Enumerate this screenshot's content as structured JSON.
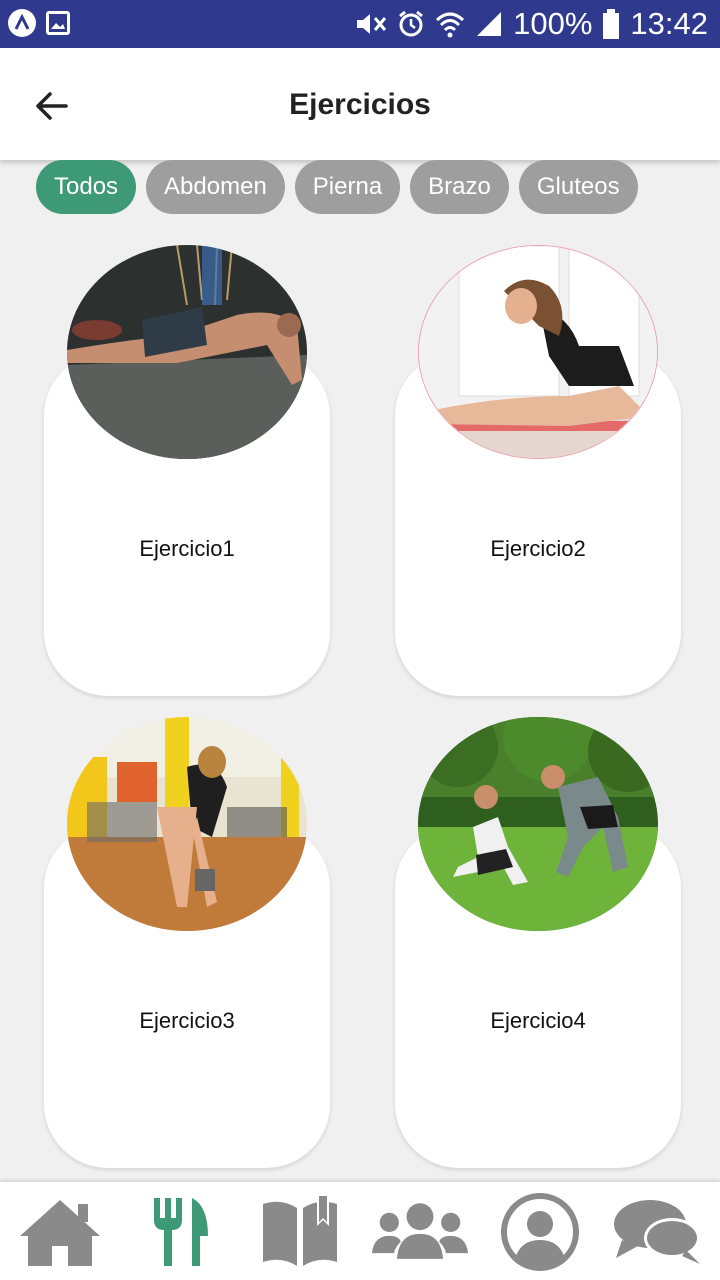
{
  "status_bar": {
    "battery": "100%",
    "time": "13:42",
    "icons": [
      "app-icon",
      "image-icon",
      "mute-icon",
      "alarm-icon",
      "wifi-icon",
      "signal-icon",
      "battery-icon"
    ]
  },
  "header": {
    "title": "Ejercicios",
    "back_icon": "back-arrow-icon"
  },
  "filters": [
    {
      "label": "Todos",
      "active": true
    },
    {
      "label": "Abdomen",
      "active": false
    },
    {
      "label": "Pierna",
      "active": false
    },
    {
      "label": "Brazo",
      "active": false
    },
    {
      "label": "Gluteos",
      "active": false
    }
  ],
  "exercises": [
    {
      "label": "Ejercicio1",
      "image": "push-up-photo"
    },
    {
      "label": "Ejercicio2",
      "image": "stretching-photo"
    },
    {
      "label": "Ejercicio3",
      "image": "gym-deadlift-photo"
    },
    {
      "label": "Ejercicio4",
      "image": "park-stretching-photo"
    }
  ],
  "bottom_nav": [
    {
      "icon": "home-icon",
      "active": false
    },
    {
      "icon": "fork-knife-icon",
      "active": true
    },
    {
      "icon": "book-icon",
      "active": false
    },
    {
      "icon": "users-icon",
      "active": false
    },
    {
      "icon": "profile-icon",
      "active": false
    },
    {
      "icon": "chat-icon",
      "active": false
    }
  ],
  "colors": {
    "status_bar": "#2f3a8f",
    "accent": "#3e9a76",
    "chip_inactive": "#9e9e9e",
    "nav_inactive": "#8a8a8a",
    "background": "#f0f0f0"
  }
}
